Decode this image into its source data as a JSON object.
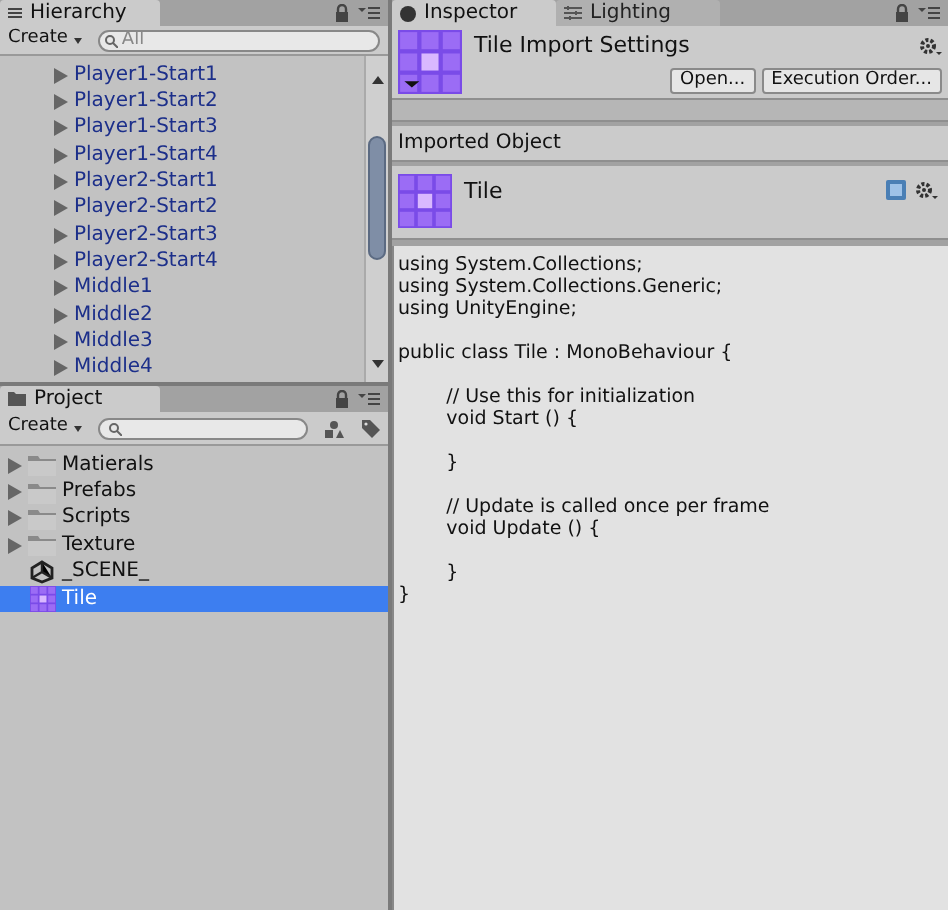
{
  "hierarchy": {
    "tab": "Hierarchy",
    "create": "Create",
    "search": {
      "placeholder": "All"
    },
    "items": [
      {
        "label": "Player1-Start1",
        "expanded": false
      },
      {
        "label": "Player1-Start2",
        "expanded": false
      },
      {
        "label": "Player1-Start3",
        "expanded": false
      },
      {
        "label": "Player1-Start4",
        "expanded": false
      },
      {
        "label": "Player2-Start1",
        "expanded": false
      },
      {
        "label": "Player2-Start2",
        "expanded": false
      },
      {
        "label": "Player2-Start3",
        "expanded": false
      },
      {
        "label": "Player2-Start4",
        "expanded": false
      },
      {
        "label": "Middle1",
        "expanded": false
      },
      {
        "label": "Middle2",
        "expanded": false
      },
      {
        "label": "Middle3",
        "expanded": false
      },
      {
        "label": "Middle4",
        "expanded": false
      }
    ]
  },
  "project": {
    "tab": "Project",
    "create": "Create",
    "items": [
      {
        "label": "Matierals",
        "kind": "folder",
        "selected": false
      },
      {
        "label": "Prefabs",
        "kind": "folder",
        "selected": false
      },
      {
        "label": "Scripts",
        "kind": "folder",
        "selected": false
      },
      {
        "label": "Texture",
        "kind": "folder",
        "selected": false
      },
      {
        "label": "_SCENE_",
        "kind": "scene",
        "selected": false
      },
      {
        "label": "Tile",
        "kind": "script",
        "selected": true
      }
    ]
  },
  "inspector": {
    "tabs": [
      {
        "label": "Inspector",
        "selected": true
      },
      {
        "label": "Lighting",
        "selected": false
      }
    ],
    "title": "Tile Import Settings",
    "buttons": [
      "Open...",
      "Execution Order..."
    ],
    "section": "Imported Object",
    "object": "Tile",
    "code": "using System.Collections;\nusing System.Collections.Generic;\nusing UnityEngine;\n\npublic class Tile : MonoBehaviour {\n\n\t// Use this for initialization\n\tvoid Start () {\n\n\t}\n\n\t// Update is called once per frame\n\tvoid Update () {\n\n\t}\n}"
  }
}
